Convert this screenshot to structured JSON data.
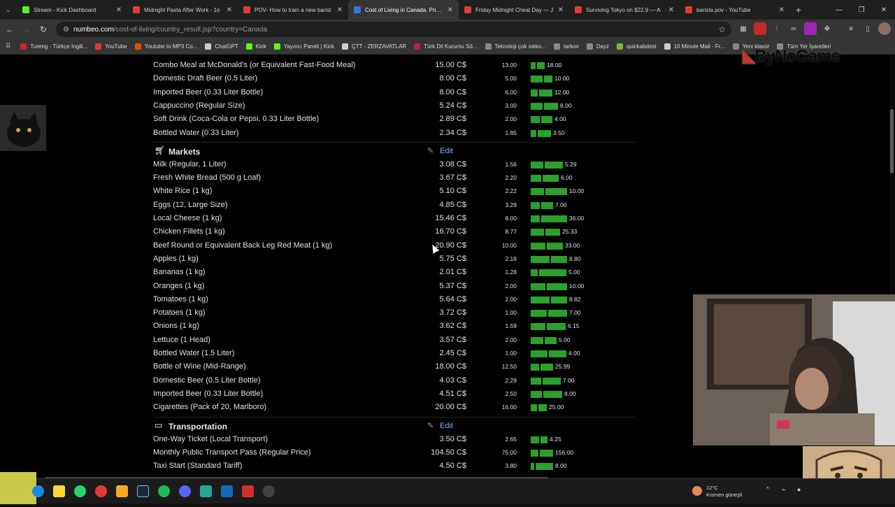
{
  "browser": {
    "tabs": [
      {
        "title": "Stream - Kick Dashboard",
        "favicon_color": "#53fc18",
        "active": false
      },
      {
        "title": "Midnight Pasta After Work - 1o",
        "favicon_color": "#e53935",
        "active": false
      },
      {
        "title": "POV- How to train a new barist",
        "favicon_color": "#e53935",
        "active": false
      },
      {
        "title": "Cost of Living in Canada. Prices",
        "favicon_color": "#2f7bd9",
        "active": true
      },
      {
        "title": "Friday Midnight Cheat Day — J",
        "favicon_color": "#e53935",
        "active": false
      },
      {
        "title": "Surviving Tokyo on $22.9 — A",
        "favicon_color": "#e53935",
        "active": false
      },
      {
        "title": "barista pov - YouTube",
        "favicon_color": "#e53935",
        "active": false
      }
    ],
    "url_host": "numbeo.com",
    "url_path": "/cost-of-living/country_result.jsp?country=Canada",
    "bookmarks": [
      {
        "label": "Tureng - Türkçe İngili...",
        "color": "#c62828"
      },
      {
        "label": "YouTube",
        "color": "#e53935"
      },
      {
        "label": "Youtube to MP3 Co...",
        "color": "#e65100"
      },
      {
        "label": "ChatGPT",
        "color": "#cccccc"
      },
      {
        "label": "Kick",
        "color": "#53fc18"
      },
      {
        "label": "Yayıncı Paneli | Kick",
        "color": "#53fc18"
      },
      {
        "label": "ÇTT - ZERZAVATLAR",
        "color": "#cccccc"
      },
      {
        "label": "Türk Dil Kurumu Sö...",
        "color": "#c2185b"
      },
      {
        "label": "Teknoloji çok sıkko...",
        "color": "#888888"
      },
      {
        "label": "tarkov",
        "color": "#888888"
      },
      {
        "label": "Dayz",
        "color": "#888888"
      },
      {
        "label": "quickabdest",
        "color": "#7cb342"
      },
      {
        "label": "10 Minute Mail - Fr...",
        "color": "#cccccc"
      },
      {
        "label": "Yeni klasör",
        "color": "#888888"
      },
      {
        "label": "Tüm Yer İşaretleri",
        "color": "#888888"
      }
    ]
  },
  "overlay": {
    "logo_brand": "ByNoGame",
    "weather_temp": "12°C",
    "weather_desc": "Kısmen güneşli"
  },
  "sections": [
    {
      "title": null,
      "rows": [
        {
          "name": "Combo Meal at McDonald's (or Equivalent Fast-Food Meal)",
          "price": "15.00 C$",
          "low": "13.00",
          "high": "18.00",
          "low_val": 13.0,
          "high_val": 18.0,
          "avg_val": 15.0
        },
        {
          "name": "Domestic Draft Beer (0.5 Liter)",
          "price": "8.00 C$",
          "low": "5.00",
          "high": "10.00",
          "low_val": 5.0,
          "high_val": 10.0,
          "avg_val": 8.0
        },
        {
          "name": "Imported Beer (0.33 Liter Bottle)",
          "price": "8.00 C$",
          "low": "6.00",
          "high": "12.00",
          "low_val": 6.0,
          "high_val": 12.0,
          "avg_val": 8.0
        },
        {
          "name": "Cappuccino (Regular Size)",
          "price": "5.24 C$",
          "low": "3.00",
          "high": "8.00",
          "low_val": 3.0,
          "high_val": 8.0,
          "avg_val": 5.24
        },
        {
          "name": "Soft Drink (Coca-Cola or Pepsi, 0.33 Liter Bottle)",
          "price": "2.89 C$",
          "low": "2.00",
          "high": "4.00",
          "low_val": 2.0,
          "high_val": 4.0,
          "avg_val": 2.89
        },
        {
          "name": "Bottled Water (0.33 Liter)",
          "price": "2.34 C$",
          "low": "1.85",
          "high": "3.50",
          "low_val": 1.85,
          "high_val": 3.5,
          "avg_val": 2.34
        }
      ]
    },
    {
      "title": "Markets",
      "edit": "Edit",
      "rows": [
        {
          "name": "Milk (Regular, 1 Liter)",
          "price": "3.08 C$",
          "low": "1.56",
          "high": "5.29",
          "low_val": 1.56,
          "high_val": 5.29,
          "avg_val": 3.08
        },
        {
          "name": "Fresh White Bread (500 g Loaf)",
          "price": "3.67 C$",
          "low": "2.20",
          "high": "6.00",
          "low_val": 2.2,
          "high_val": 6.0,
          "avg_val": 3.67
        },
        {
          "name": "White Rice (1 kg)",
          "price": "5.10 C$",
          "low": "2.22",
          "high": "10.00",
          "low_val": 2.22,
          "high_val": 10.0,
          "avg_val": 5.1
        },
        {
          "name": "Eggs (12, Large Size)",
          "price": "4.85 C$",
          "low": "3.29",
          "high": "7.00",
          "low_val": 3.29,
          "high_val": 7.0,
          "avg_val": 4.85
        },
        {
          "name": "Local Cheese (1 kg)",
          "price": "15.46 C$",
          "low": "8.00",
          "high": "36.00",
          "low_val": 8.0,
          "high_val": 36.0,
          "avg_val": 15.46
        },
        {
          "name": "Chicken Fillets (1 kg)",
          "price": "16.70 C$",
          "low": "8.77",
          "high": "25.33",
          "low_val": 8.77,
          "high_val": 25.33,
          "avg_val": 16.7
        },
        {
          "name": "Beef Round or Equivalent Back Leg Red Meat (1 kg)",
          "price": "20.90 C$",
          "low": "10.00",
          "high": "33.00",
          "low_val": 10.0,
          "high_val": 33.0,
          "avg_val": 20.9
        },
        {
          "name": "Apples (1 kg)",
          "price": "5.75 C$",
          "low": "2.18",
          "high": "8.80",
          "low_val": 2.18,
          "high_val": 8.8,
          "avg_val": 5.75
        },
        {
          "name": "Bananas (1 kg)",
          "price": "2.01 C$",
          "low": "1.28",
          "high": "5.00",
          "low_val": 1.28,
          "high_val": 5.0,
          "avg_val": 2.01
        },
        {
          "name": "Oranges (1 kg)",
          "price": "5.37 C$",
          "low": "2.00",
          "high": "10.00",
          "low_val": 2.0,
          "high_val": 10.0,
          "avg_val": 5.37
        },
        {
          "name": "Tomatoes (1 kg)",
          "price": "5.64 C$",
          "low": "2.00",
          "high": "8.82",
          "low_val": 2.0,
          "high_val": 8.82,
          "avg_val": 5.64
        },
        {
          "name": "Potatoes (1 kg)",
          "price": "3.72 C$",
          "low": "1.00",
          "high": "7.00",
          "low_val": 1.0,
          "high_val": 7.0,
          "avg_val": 3.72
        },
        {
          "name": "Onions (1 kg)",
          "price": "3.62 C$",
          "low": "1.59",
          "high": "6.15",
          "low_val": 1.59,
          "high_val": 6.15,
          "avg_val": 3.62
        },
        {
          "name": "Lettuce (1 Head)",
          "price": "3.57 C$",
          "low": "2.00",
          "high": "5.00",
          "low_val": 2.0,
          "high_val": 5.0,
          "avg_val": 3.57
        },
        {
          "name": "Bottled Water (1.5 Liter)",
          "price": "2.45 C$",
          "low": "1.00",
          "high": "4.00",
          "low_val": 1.0,
          "high_val": 4.0,
          "avg_val": 2.45
        },
        {
          "name": "Bottle of Wine (Mid-Range)",
          "price": "18.00 C$",
          "low": "12.50",
          "high": "25.99",
          "low_val": 12.5,
          "high_val": 25.99,
          "avg_val": 18.0
        },
        {
          "name": "Domestic Beer (0.5 Liter Bottle)",
          "price": "4.03 C$",
          "low": "2.29",
          "high": "7.00",
          "low_val": 2.29,
          "high_val": 7.0,
          "avg_val": 4.03
        },
        {
          "name": "Imported Beer (0.33 Liter Bottle)",
          "price": "4.51 C$",
          "low": "2.50",
          "high": "8.00",
          "low_val": 2.5,
          "high_val": 8.0,
          "avg_val": 4.51
        },
        {
          "name": "Cigarettes (Pack of 20, Marlboro)",
          "price": "20.00 C$",
          "low": "16.00",
          "high": "25.00",
          "low_val": 16.0,
          "high_val": 25.0,
          "avg_val": 20.0
        }
      ]
    },
    {
      "title": "Transportation",
      "edit": "Edit",
      "rows": [
        {
          "name": "One-Way Ticket (Local Transport)",
          "price": "3.50 C$",
          "low": "2.65",
          "high": "4.25",
          "low_val": 2.65,
          "high_val": 4.25,
          "avg_val": 3.5
        },
        {
          "name": "Monthly Public Transport Pass (Regular Price)",
          "price": "104.50 C$",
          "low": "75.00",
          "high": "156.00",
          "low_val": 75.0,
          "high_val": 156.0,
          "avg_val": 104.5
        },
        {
          "name": "Taxi Start (Standard Tariff)",
          "price": "4.50 C$",
          "low": "3.80",
          "high": "8.00",
          "low_val": 3.8,
          "high_val": 8.0,
          "avg_val": 4.5
        }
      ]
    }
  ]
}
